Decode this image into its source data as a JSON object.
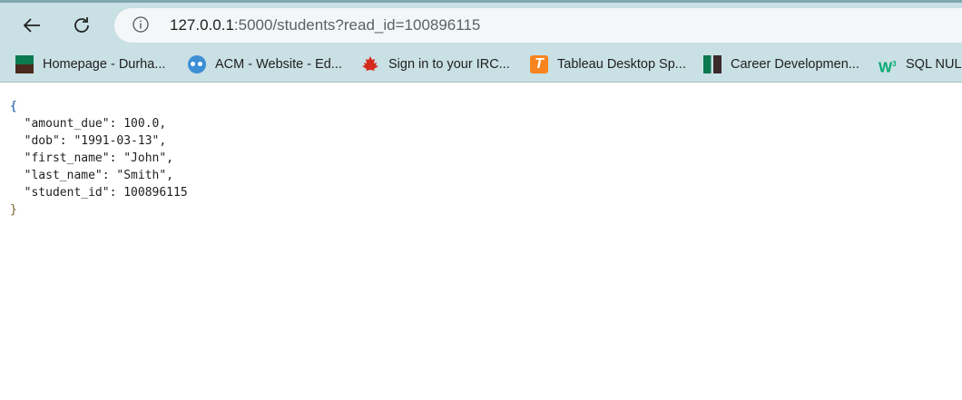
{
  "browser": {
    "url_host": "127.0.0.1",
    "url_rest": ":5000/students?read_id=100896115",
    "bookmarks": [
      {
        "label": "Homepage - Durha...",
        "icon": "durham-logo-icon"
      },
      {
        "label": "ACM - Website - Ed...",
        "icon": "owl-icon"
      },
      {
        "label": "Sign in to your IRC...",
        "icon": "maple-leaf-icon"
      },
      {
        "label": "Tableau Desktop Sp...",
        "icon": "tableau-t-icon"
      },
      {
        "label": "Career Developmen...",
        "icon": "career-logo-icon"
      },
      {
        "label": "SQL NULL",
        "icon": "w3schools-icon"
      }
    ]
  },
  "json": {
    "open": "{",
    "lines": [
      "  \"amount_due\": 100.0,",
      "  \"dob\": \"1991-03-13\",",
      "  \"first_name\": \"John\",",
      "  \"last_name\": \"Smith\",",
      "  \"student_id\": 100896115"
    ],
    "close": "}"
  }
}
